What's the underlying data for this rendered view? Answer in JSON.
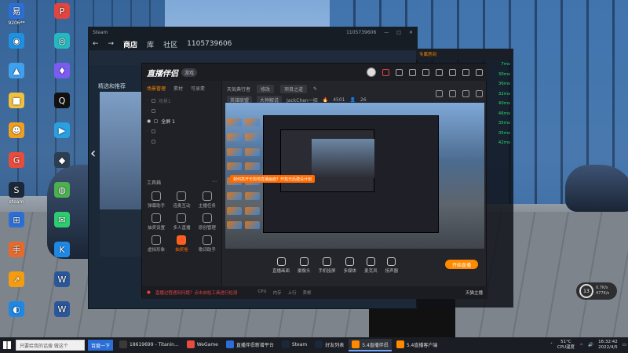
{
  "desktop": {
    "icons": [
      {
        "label": "9206**",
        "glyph": "易",
        "color": "#2b6fd6"
      },
      {
        "label": "",
        "glyph": "P",
        "color": "#e0453f"
      },
      {
        "label": "",
        "glyph": "◉",
        "color": "#1f8fe0"
      },
      {
        "label": "",
        "glyph": "◎",
        "color": "#25b8c0"
      },
      {
        "label": "",
        "glyph": "▲",
        "color": "#3fa0f0"
      },
      {
        "label": "",
        "glyph": "♦",
        "color": "#7b5cf0"
      },
      {
        "label": "",
        "glyph": "■",
        "color": "#f0c040"
      },
      {
        "label": "",
        "glyph": "Q",
        "color": "#111111"
      },
      {
        "label": "",
        "glyph": "☻",
        "color": "#f0a020"
      },
      {
        "label": "",
        "glyph": "▶",
        "color": "#2aa0e0"
      },
      {
        "label": "",
        "glyph": "G",
        "color": "#e84c3d"
      },
      {
        "label": "",
        "glyph": "◆",
        "color": "#2c3e50"
      },
      {
        "label": "steam",
        "glyph": "S",
        "color": "#1b2838"
      },
      {
        "label": "",
        "glyph": "◍",
        "color": "#4caf50"
      },
      {
        "label": "",
        "glyph": "⊞",
        "color": "#2b6fd6"
      },
      {
        "label": "",
        "glyph": "✉",
        "color": "#2ecc71"
      },
      {
        "label": "",
        "glyph": "手",
        "color": "#e66a2c"
      },
      {
        "label": "",
        "glyph": "K",
        "color": "#1e88e5"
      },
      {
        "label": "",
        "glyph": "↗",
        "color": "#f39c12"
      },
      {
        "label": "",
        "glyph": "W",
        "color": "#2b579a"
      },
      {
        "label": "",
        "glyph": "◐",
        "color": "#1e88e5"
      },
      {
        "label": "",
        "glyph": "W",
        "color": "#2b579a"
      }
    ]
  },
  "steam": {
    "nav": {
      "store": "商店",
      "library": "库",
      "community": "社区",
      "account": "1105739606"
    },
    "featured": "精选和推荐",
    "account_small": "1105739606"
  },
  "app": {
    "logo": "直播伴侣",
    "badge": "游戏",
    "left_tabs": [
      "场景管理",
      "素材",
      "可录素"
    ],
    "scenes": [
      {
        "label": "场景1",
        "active": false
      },
      {
        "label": "",
        "active": false
      },
      {
        "label": "全屏 1",
        "active": true
      },
      {
        "label": "",
        "active": false
      },
      {
        "label": "",
        "active": false
      }
    ],
    "tools_header": "工具箱",
    "tools": [
      {
        "label": "弹幕助手",
        "hl": false
      },
      {
        "label": "连麦互动",
        "hl": false
      },
      {
        "label": "主播任务",
        "hl": false
      },
      {
        "label": "抽奖设置",
        "hl": false
      },
      {
        "label": "多人直播",
        "hl": false
      },
      {
        "label": "原创管理",
        "hl": false
      },
      {
        "label": "虚拟形象",
        "hl": false
      },
      {
        "label": "抽奖卷",
        "hl": true
      },
      {
        "label": "歌词助手",
        "hl": false
      }
    ],
    "header": {
      "title": "天気典行者",
      "pill1": "修改",
      "pill2": "项目之道",
      "tag1": "英雄联盟",
      "tag2": "大神解说",
      "user": "JackChen一招",
      "stat": "4501",
      "count": "26"
    },
    "toast": "如何高开无拘地直播画面？开拓无后建设计划",
    "bottom_buttons": [
      "直播画面",
      "摄像头",
      "手机投屏",
      "多媒体",
      "麦克风",
      "扬声器"
    ],
    "start_button": "开始直播",
    "status_warn": "直播过程遇到问题？点击自检工具进行检测",
    "status_items": [
      "CPU",
      "内存",
      "上行",
      "丢帧"
    ],
    "status_right": "天猫主播"
  },
  "chat": {
    "title": "专属房间",
    "times": [
      "7ms",
      "30ms",
      "36ms",
      "32ms",
      "40ms",
      "46ms",
      "35ms",
      "35ms",
      "42ms"
    ]
  },
  "perf": {
    "percent": "13",
    "line1": "0.7K/s",
    "line2": "477K/s"
  },
  "taskbar": {
    "search_placeholder": "只要给我的话搜 做这个",
    "search_button": "百度一下",
    "tasks": [
      {
        "label": "18619699 - Titanin...",
        "color": "#3a3a3a",
        "active": false
      },
      {
        "label": "WeGame",
        "color": "#e84c3d",
        "active": false
      },
      {
        "label": "直播伴侣新增平台",
        "color": "#2b6fd6",
        "active": false
      },
      {
        "label": "Steam",
        "color": "#1b2838",
        "active": false
      },
      {
        "label": "好友列表",
        "color": "#1b2838",
        "active": false
      },
      {
        "label": "5.4直播伴侣",
        "color": "#ff8a00",
        "active": true
      },
      {
        "label": "5.4直播客户端",
        "color": "#ff8a00",
        "active": false
      }
    ],
    "weather": "51°C",
    "cpu_label": "CPU温度",
    "time": "16:32:42",
    "date": "2022/4/5"
  }
}
